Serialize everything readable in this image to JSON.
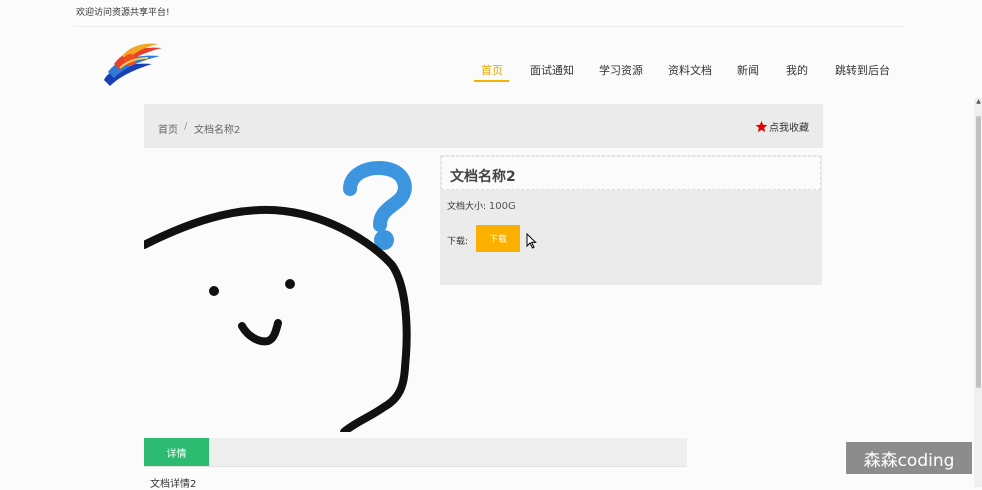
{
  "header": {
    "welcome_text": "欢迎访问资源共享平台!"
  },
  "nav": {
    "items": [
      {
        "label": "首页",
        "active": true
      },
      {
        "label": "面试通知"
      },
      {
        "label": "学习资源"
      },
      {
        "label": "资料文档"
      },
      {
        "label": "新闻"
      },
      {
        "label": "我的"
      },
      {
        "label": "跳转到后台"
      }
    ]
  },
  "breadcrumb": {
    "home": "首页",
    "separator": "/",
    "current": "文档名称2"
  },
  "favorite": {
    "label": "点我收藏",
    "icon": "star-icon",
    "color": "#e60000"
  },
  "document": {
    "title": "文档名称2",
    "size_label": "文档大小:",
    "size_value": "100G",
    "download_label": "下载:",
    "download_button": "下载"
  },
  "tabs": {
    "detail_label": "详情",
    "detail_content": "文档详情2"
  },
  "overlay": {
    "watermark": "森森coding"
  },
  "colors": {
    "accent": "#f0b400",
    "download_button": "#fbb000",
    "tab_active": "#2dbb72",
    "panel_bg": "#eaebea"
  }
}
